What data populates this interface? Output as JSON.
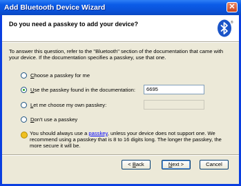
{
  "window": {
    "title": "Add Bluetooth Device Wizard",
    "close_glyph": "✕"
  },
  "header": {
    "title": "Do you need a passkey to add your device?",
    "logo_icon": "bluetooth-icon"
  },
  "intro": "To answer this question, refer to the \"Bluetooth\" section of the documentation that came with your device. If the documentation specifies a passkey, use that one.",
  "options": [
    {
      "accel": "C",
      "rest": "hoose a passkey for me",
      "selected": false
    },
    {
      "accel": "U",
      "rest": "se the passkey found in the documentation:",
      "selected": true
    },
    {
      "accel": "L",
      "rest": "et me choose my own passkey:",
      "selected": false
    },
    {
      "accel": "D",
      "rest": "on't use a passkey",
      "selected": false
    }
  ],
  "fields": {
    "documentation_passkey": "6695",
    "own_passkey": ""
  },
  "note": {
    "before": "You should always use a ",
    "link": "passkey",
    "after": ", unless your device does not support one. We recommend using a passkey that is 8 to 16 digits long. The longer the passkey, the more secure it will be."
  },
  "buttons": {
    "back": {
      "prefix": "< ",
      "accel": "B",
      "rest": "ack"
    },
    "next": {
      "accel": "N",
      "rest": "ext >"
    },
    "cancel": "Cancel"
  }
}
